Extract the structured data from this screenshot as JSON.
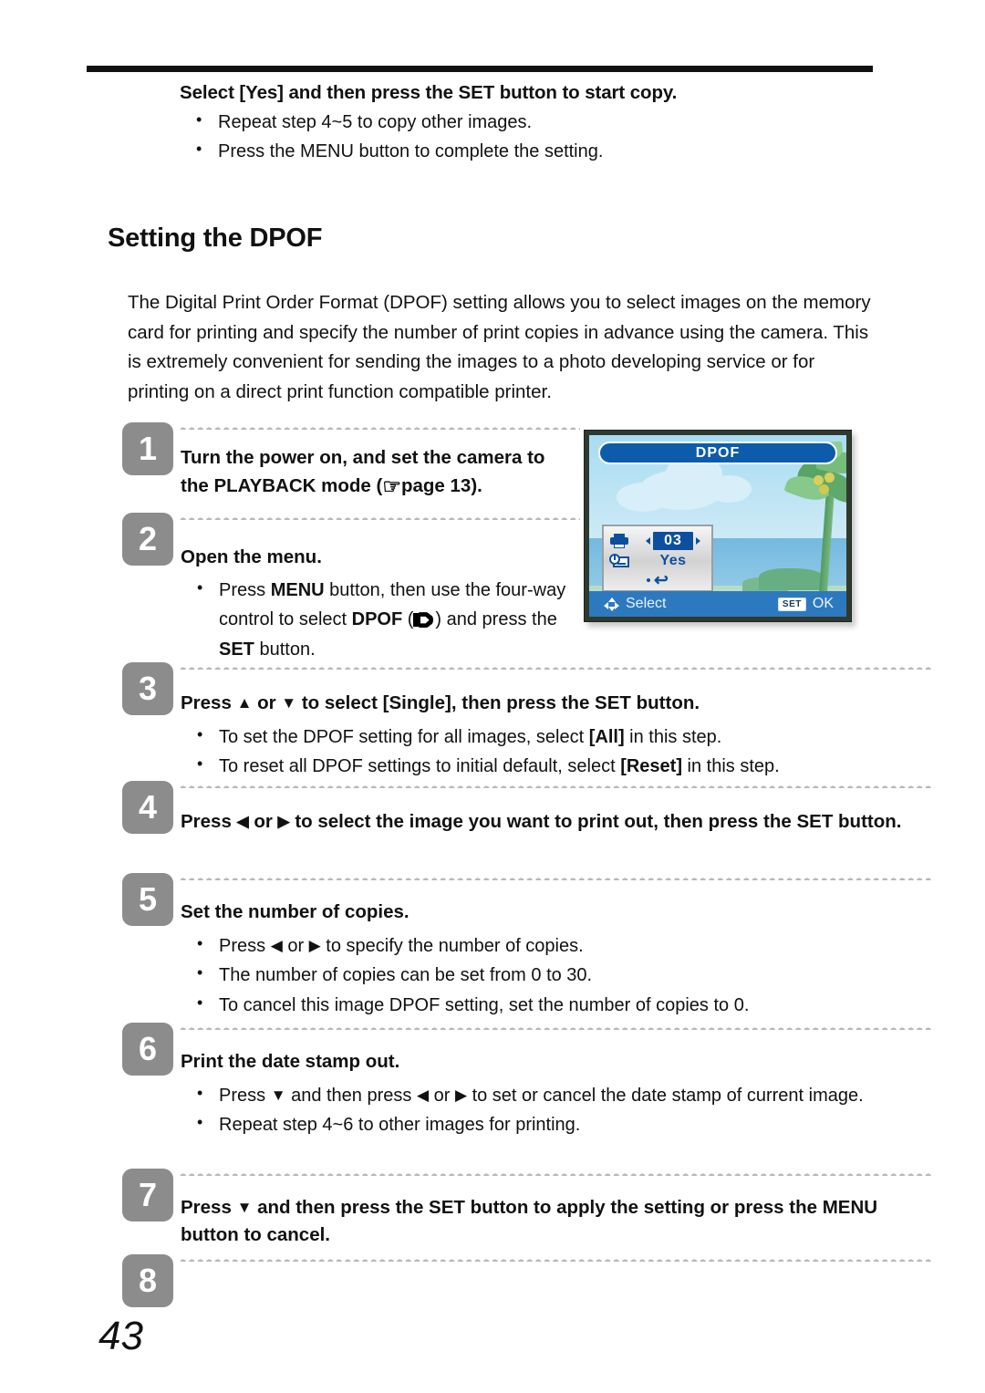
{
  "document": {
    "page_number": "43",
    "section_title": "Setting the DPOF"
  },
  "intro": {
    "heading": "Select [Yes] and then press the SET button to start copy.",
    "bullets": [
      "Repeat step 4~5 to copy other images.",
      "Press the MENU button to complete the setting."
    ]
  },
  "paragraph": "The Digital Print Order Format (DPOF) setting allows you to select images on the memory card for printing and specify the number of print copies in advance using the camera. This is extremely convenient for sending the images to a photo developing service or for printing on a direct print function compatible printer.",
  "steps": [
    {
      "number": "1",
      "title_before": "Turn the power on, and set the camera to the PLAYBACK mode (",
      "title_after": "page 13).",
      "icon": "pointing-hand-icon",
      "bullets": []
    },
    {
      "number": "2",
      "title": "Open the menu.",
      "bullets": [
        "Press the MENU button, then use the four-way control to select DPOF (  ) and press the SET button."
      ]
    },
    {
      "number": "3",
      "title": "Press ▲ or ▼ to select [Single], then press the SET button.",
      "bullets": [
        "To set the DPOF setting for all images, select [All] in this step.",
        "To reset all DPOF settings to initial default, select [Reset] in this step."
      ]
    },
    {
      "number": "4",
      "title": "Press ◀ or ▶ to select the image you want to print out, then press the SET button.",
      "bullets": []
    },
    {
      "number": "5",
      "title": "Set the number of copies.",
      "bullets": [
        "Press ◀ or ▶ to specify the number of copies.",
        "The number of copies can be set from 0 to 30.",
        "To cancel this image DPOF setting, set the number of copies to 0."
      ]
    },
    {
      "number": "6",
      "title": "Print the date stamp out.",
      "bullets": [
        "Press ▼ and then press ◀ or ▶ to set or cancel the date stamp of current image.",
        "Repeat step 4~6 to other images for printing."
      ]
    },
    {
      "number": "7",
      "title": "Press ▼ and then press the SET button to apply the setting or press the MENU button to cancel.",
      "bullets": []
    },
    {
      "number": "8",
      "title": "",
      "bullets": []
    }
  ],
  "lcd_screen": {
    "title": "DPOF",
    "copies_value": "03",
    "date_stamp_value": "Yes",
    "hint_select": "Select",
    "hint_ok": "OK",
    "set_chip": "SET",
    "colors": {
      "title_bar": "#0d5cab",
      "bottom_bar": "#2d79bf",
      "highlight": "#0d4f9e",
      "sky": "#a8dcf2",
      "sea": "#74b9e0",
      "beach": "#b6dcc2"
    }
  }
}
